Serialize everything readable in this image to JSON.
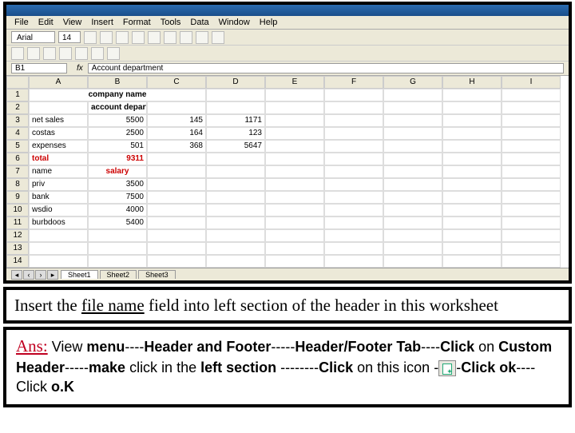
{
  "excel": {
    "menus": [
      "File",
      "Edit",
      "View",
      "Insert",
      "Format",
      "Tools",
      "Data",
      "Window",
      "Help"
    ],
    "font": "Arial",
    "size": "14",
    "namebox": "B1",
    "formula": "Account department",
    "cols": [
      "A",
      "B",
      "C",
      "D",
      "E",
      "F",
      "G",
      "H",
      "I"
    ],
    "rows": {
      "1": {
        "merged": "company name"
      },
      "2": {
        "a": "",
        "b": "account department"
      },
      "3": {
        "a": "net sales",
        "b": "5500",
        "c": "145",
        "d": "1171"
      },
      "4": {
        "a": "costas",
        "b": "2500",
        "c": "164",
        "d": "123"
      },
      "5": {
        "a": "expenses",
        "b": "501",
        "c": "368",
        "d": "5647"
      },
      "6": {
        "a": "total",
        "b": "9311"
      },
      "7": {
        "a": "name",
        "b": "salary"
      },
      "8": {
        "a": "priv",
        "b": "3500"
      },
      "9": {
        "a": "bank",
        "b": "7500"
      },
      "10": {
        "a": "wsdio",
        "b": "4000"
      },
      "11": {
        "a": "burbdoos",
        "b": "5400"
      }
    },
    "sheets": [
      "Sheet1",
      "Sheet2",
      "Sheet3"
    ]
  },
  "question": {
    "pre": "Insert the ",
    "file": "file name",
    "mid": " field into ",
    "left": "left",
    "post": " section of the header  in this worksheet"
  },
  "answer": {
    "label": "Ans:",
    "seg1": " View ",
    "b1": "menu",
    "seg2": "----",
    "b2": "Header and Footer",
    "seg3": "-----",
    "b3": "Header/Footer Tab",
    "seg4": "----",
    "b4": "Click",
    "seg5": " on ",
    "b5": "Custom Header",
    "seg6": "-----",
    "b6": "make",
    "seg7": " click in the  ",
    "b7": "left section",
    "seg8": " --------",
    "b8": "Click",
    "seg9": " on this icon    -",
    "seg10": "-",
    "b9": "Click ok",
    "seg11": "----Click ",
    "b10": "o.K"
  }
}
